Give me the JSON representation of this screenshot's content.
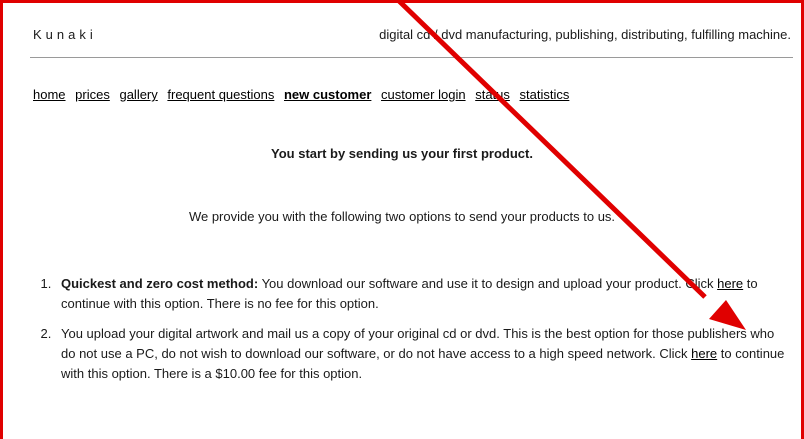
{
  "header": {
    "brand": "Kunaki",
    "tagline": "digital cd / dvd manufacturing, publishing, distributing, fulfilling machine."
  },
  "nav": {
    "items": [
      {
        "label": "home",
        "active": false
      },
      {
        "label": "prices",
        "active": false
      },
      {
        "label": "gallery",
        "active": false
      },
      {
        "label": "frequent questions",
        "active": false
      },
      {
        "label": "new customer",
        "active": true
      },
      {
        "label": "customer login",
        "active": false
      },
      {
        "label": "status",
        "active": false
      },
      {
        "label": "statistics",
        "active": false
      }
    ]
  },
  "main": {
    "heading": "You start by sending us your first product.",
    "intro": "We provide you with the following two options to send your products to us.",
    "options": [
      {
        "title": "Quickest and zero cost method:",
        "text_before": " You download our software and use it to design and upload your product. Click ",
        "link": "here",
        "text_after": " to continue with this option. There is no fee for this option."
      },
      {
        "title": "",
        "text_before": "You upload your digital artwork and mail us a copy of your original cd or dvd. This is the best option for those publishers who do not use a PC, do not wish to download our software, or do not have access to a high speed network. Click ",
        "link": "here",
        "text_after": " to continue with this option. There is a $10.00 fee for this option."
      }
    ]
  },
  "annotation": {
    "color": "#e00000"
  }
}
